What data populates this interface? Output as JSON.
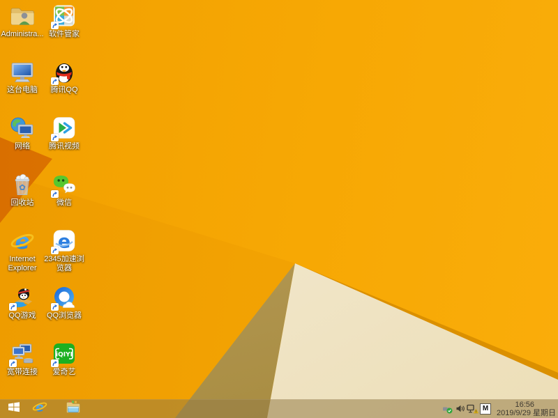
{
  "wallpaper": {
    "style": "windows-8.1-amber-facets",
    "base_color": "#F7A804",
    "facet_dark_left": "#E07700",
    "facet_olive": "#B0944F",
    "facet_cream": "#F2E9CF",
    "facet_ridge": "#DB9000"
  },
  "desktop": {
    "icons": [
      {
        "label": "Administra...",
        "name": "administrator-folder"
      },
      {
        "label": "软件管家",
        "name": "software-manager"
      },
      {
        "label": "这台电脑",
        "name": "this-pc"
      },
      {
        "label": "腾讯QQ",
        "name": "tencent-qq"
      },
      {
        "label": "网络",
        "name": "network"
      },
      {
        "label": "腾讯视频",
        "name": "tencent-video"
      },
      {
        "label": "回收站",
        "name": "recycle-bin"
      },
      {
        "label": "微信",
        "name": "wechat"
      },
      {
        "label": "Internet Explorer",
        "name": "internet-explorer"
      },
      {
        "label": "2345加速浏览器",
        "name": "2345-browser"
      },
      {
        "label": "QQ游戏",
        "name": "qq-games"
      },
      {
        "label": "QQ浏览器",
        "name": "qq-browser"
      },
      {
        "label": "宽带连接",
        "name": "broadband-connection"
      },
      {
        "label": "爱奇艺",
        "name": "iqiyi"
      }
    ]
  },
  "taskbar": {
    "buttons": [
      "start",
      "internet-explorer",
      "file-explorer"
    ],
    "tray": {
      "icons": [
        "safely-remove-hardware",
        "volume",
        "network-warning",
        "input-method"
      ],
      "input_method_label": "M",
      "clock": {
        "time": "16:56",
        "date": "2019/9/29 星期日"
      }
    }
  }
}
